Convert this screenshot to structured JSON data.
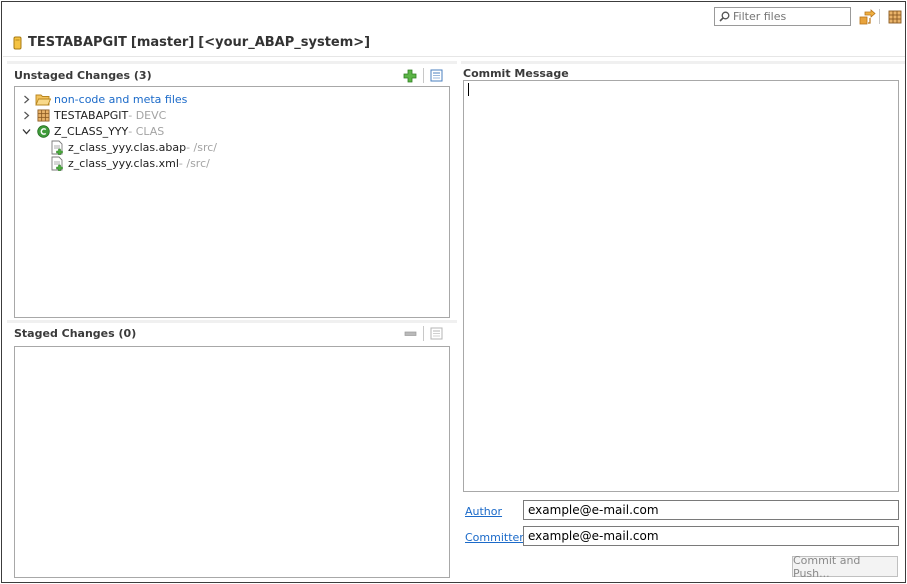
{
  "toolbar": {
    "filter_placeholder": "Filter files",
    "icons": [
      "search-icon",
      "switch-repository-icon",
      "package-icon"
    ]
  },
  "header": {
    "repo_name": "TESTABAPGIT",
    "branch": "[master]",
    "system": "[<your_ABAP_system>]"
  },
  "unstaged": {
    "title": "Unstaged Changes (3)",
    "items": [
      {
        "label": "non-code and meta files",
        "suffix": "",
        "icon": "folder-icon",
        "expanded": false
      },
      {
        "label": "TESTABAPGIT",
        "suffix": " - DEVC",
        "icon": "package-icon",
        "expanded": false
      },
      {
        "label": "Z_CLASS_YYY",
        "suffix": " - CLAS",
        "icon": "class-icon",
        "expanded": true
      },
      {
        "label": "z_class_yyy.clas.abap",
        "suffix": " - /src/",
        "icon": "new-file-icon"
      },
      {
        "label": "z_class_yyy.clas.xml",
        "suffix": " - /src/",
        "icon": "new-file-icon"
      }
    ]
  },
  "staged": {
    "title": "Staged Changes (0)"
  },
  "commit": {
    "title": "Commit Message",
    "message": "",
    "author_label": "Author",
    "author_value": "example@e-mail.com",
    "committer_label": "Committer",
    "committer_value": "example@e-mail.com",
    "button_label": "Commit and Push..."
  },
  "colors": {
    "link": "#1b6ac9",
    "muted": "#a3a3a3",
    "add_green": "#3fa53a"
  }
}
